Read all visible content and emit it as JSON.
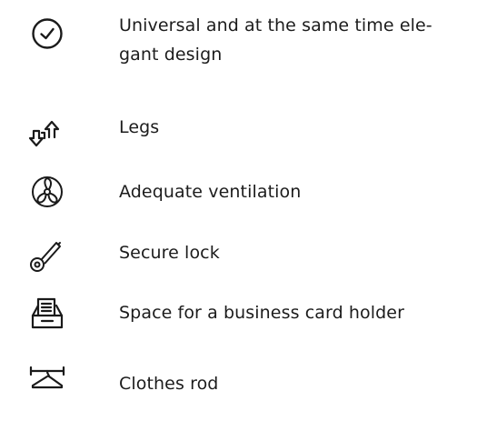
{
  "features": [
    {
      "icon": "check-circle-icon",
      "text": "Universal and at the same time ele-gant design"
    },
    {
      "icon": "legs-arrows-icon",
      "text": "Legs"
    },
    {
      "icon": "ventilation-fan-icon",
      "text": "Adequate ventilation"
    },
    {
      "icon": "key-icon",
      "text": "Secure lock"
    },
    {
      "icon": "card-holder-icon",
      "text": "Space for a business card holder"
    },
    {
      "icon": "clothes-hanger-icon",
      "text": "Clothes rod"
    }
  ]
}
